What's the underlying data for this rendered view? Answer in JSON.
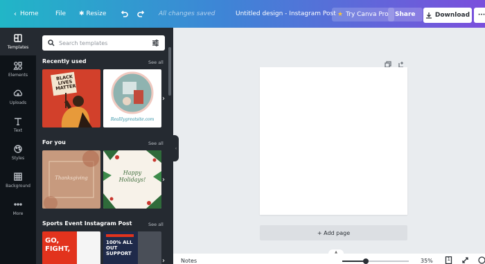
{
  "topbar": {
    "home": "Home",
    "file": "File",
    "resize": "Resize",
    "save_status": "All changes saved",
    "title": "Untitled design - Instagram Post",
    "try_pro": "Try Canva Pro",
    "share": "Share",
    "download": "Download",
    "more": "···"
  },
  "rail": [
    {
      "label": "Templates",
      "icon": "templates-icon"
    },
    {
      "label": "Elements",
      "icon": "elements-icon"
    },
    {
      "label": "Uploads",
      "icon": "uploads-icon"
    },
    {
      "label": "Text",
      "icon": "text-icon"
    },
    {
      "label": "Styles",
      "icon": "styles-icon"
    },
    {
      "label": "Background",
      "icon": "background-icon"
    },
    {
      "label": "More",
      "icon": "more-icon"
    }
  ],
  "panel": {
    "search_placeholder": "Search templates",
    "sections": [
      {
        "title": "Recently used",
        "see_all": "See all",
        "templates": [
          {
            "text": "BLACK LIVES MATTER"
          },
          {
            "text": "Realllygreatsite.com"
          }
        ]
      },
      {
        "title": "For you",
        "see_all": "See all",
        "templates": [
          {
            "text": "Thanksgiving"
          },
          {
            "text": "Happy Holidays!"
          }
        ]
      },
      {
        "title": "Sports Event Instagram Post",
        "see_all": "See all",
        "templates": [
          {
            "text": "GO, FIGHT,"
          },
          {
            "text": "100% ALL OUT SUPPORT"
          }
        ]
      }
    ]
  },
  "canvas": {
    "add_page": "+ Add page"
  },
  "bottombar": {
    "notes": "Notes",
    "zoom": 35,
    "zoom_label": "35%",
    "page_count": "1"
  },
  "colors": {
    "accent_gradient_start": "#21b6c7",
    "accent_gradient_end": "#7b4fdc",
    "rail_bg": "#0e1318",
    "panel_bg": "#252a31",
    "workspace_bg": "#e9ecef",
    "pro_crown": "#f8c43a"
  }
}
